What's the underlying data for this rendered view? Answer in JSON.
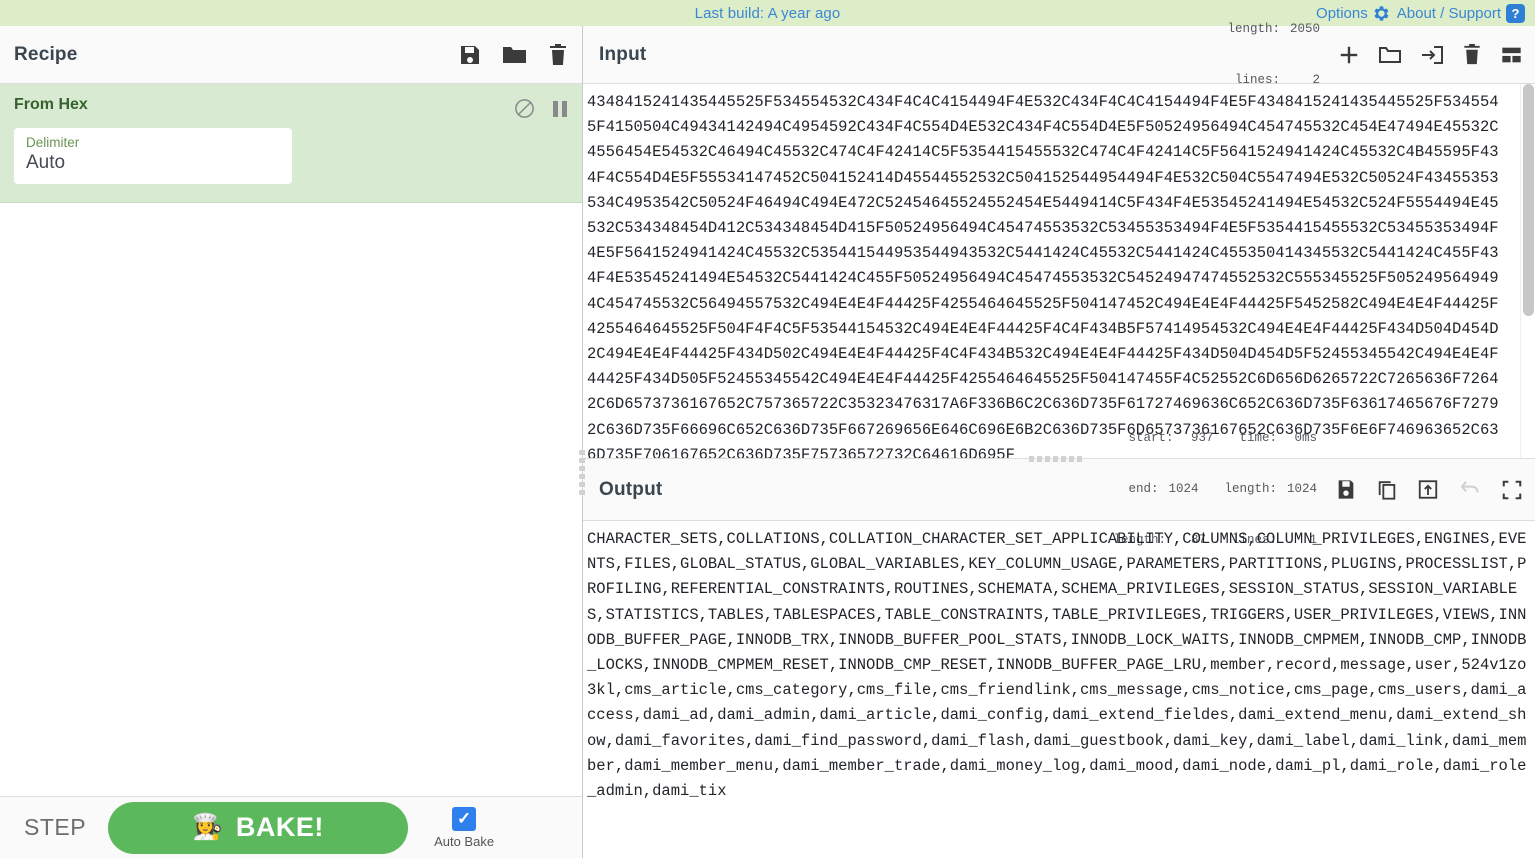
{
  "banner": {
    "build_text": "Last build: A year ago",
    "options_label": "Options",
    "about_label": "About / Support",
    "link_color": "#3a87d4",
    "background": "#dcedc8"
  },
  "recipe": {
    "title": "Recipe",
    "icons": [
      "save-icon",
      "folder-icon",
      "trash-icon"
    ],
    "operations": [
      {
        "name": "From Hex",
        "disable_icon": "disable-icon",
        "breakpoint_icon": "pause-icon",
        "args": [
          {
            "label": "Delimiter",
            "value": "Auto"
          }
        ]
      }
    ],
    "controls": {
      "step_label": "STEP",
      "bake_label": "BAKE!",
      "bake_emoji": "👩‍🍳",
      "bake_color": "#5cb85c",
      "autobake_label": "Auto Bake",
      "autobake_checked": true,
      "checkbox_color": "#2f80ed"
    }
  },
  "input": {
    "title": "Input",
    "stats": {
      "length_key": "length:",
      "length_value": "2050",
      "lines_key": "lines:",
      "lines_value": "2"
    },
    "icons": [
      "add-icon",
      "folder-open-icon",
      "import-icon",
      "trash-icon",
      "tabs-icon"
    ],
    "text": "4348415241435445525F534554532C434F4C4C4154494F4E532C434F4C4C4154494F4E5F4348415241435445525F5345545F4150504C49434142494C4954592C434F4C554D4E532C434F4C554D4E5F50524956494C454745532C454E47494E45532C4556454E54532C46494C45532C474C4F42414C5F5354415455532C474C4F42414C5F5641524941424C45532C4B45595F434F4C554D4E5F55534147452C504152414D45544552532C504152544954494F4E532C504C5547494E532C50524F43455353534C4953542C50524F46494C494E472C52454645524552454E5449414C5F434F4E53545241494E54532C524F5554494E45532C534348454D412C534348454D415F50524956494C45474553532C53455353494F4E5F5354415455532C53455353494F4E5F5641524941424C45532C535441544953544943532C5441424C45532C5441424C455350414345532C5441424C455F434F4E53545241494E54532C5441424C455F50524956494C45474553532C54524947474552532C555345525F5052495649494C454745532C56494557532C494E4E4F44425F4255464645525F504147452C494E4E4F44425F5452582C494E4E4F44425F4255464645525F504F4F4C5F53544154532C494E4E4F44425F4C4F434B5F57414954532C494E4E4F44425F434D504D454D2C494E4E4F44425F434D502C494E4E4F44425F4C4F434B532C494E4E4F44425F434D504D454D5F52455345542C494E4E4F44425F434D505F52455345542C494E4E4F44425F4255464645525F504147455F4C52552C6D656D6265722C7265636F72642C6D6573736167652C757365722C35323476317A6F336B6C2C636D735F61727469636C652C636D735F63617465676F72792C636D735F66696C652C636D735F667269656E646C696E6B2C636D735F6D6573736167652C636D735F6E6F746963652C636D735F706167652C636D735F75736572732C64616D695F"
  },
  "output": {
    "title": "Output",
    "stats": {
      "start_key": "start:",
      "start_value": "937",
      "end_key": "end:",
      "end_value": "1024",
      "sel_length_key": "length:",
      "sel_length_value": "87",
      "time_key": "time:",
      "time_value": "0ms",
      "length_key": "length:",
      "length_value": "1024",
      "lines_key": "lines:",
      "lines_value": "1"
    },
    "icons": [
      "save-icon",
      "copy-icon",
      "bake-to-input-icon",
      "undo-icon",
      "maximize-icon"
    ],
    "text": "CHARACTER_SETS,COLLATIONS,COLLATION_CHARACTER_SET_APPLICABILITY,COLUMNS,COLUMN_PRIVILEGES,ENGINES,EVENTS,FILES,GLOBAL_STATUS,GLOBAL_VARIABLES,KEY_COLUMN_USAGE,PARAMETERS,PARTITIONS,PLUGINS,PROCESSLIST,PROFILING,REFERENTIAL_CONSTRAINTS,ROUTINES,SCHEMATA,SCHEMA_PRIVILEGES,SESSION_STATUS,SESSION_VARIABLES,STATISTICS,TABLES,TABLESPACES,TABLE_CONSTRAINTS,TABLE_PRIVILEGES,TRIGGERS,USER_PRIVILEGES,VIEWS,INNODB_BUFFER_PAGE,INNODB_TRX,INNODB_BUFFER_POOL_STATS,INNODB_LOCK_WAITS,INNODB_CMPMEM,INNODB_CMP,INNODB_LOCKS,INNODB_CMPMEM_RESET,INNODB_CMP_RESET,INNODB_BUFFER_PAGE_LRU,member,record,message,user,524v1zo3kl,cms_article,cms_category,cms_file,cms_friendlink,cms_message,cms_notice,cms_page,cms_users,dami_access,dami_ad,dami_admin,dami_article,dami_config,dami_extend_fieldes,dami_extend_menu,dami_extend_show,dami_favorites,dami_find_password,dami_flash,dami_guestbook,dami_key,dami_label,dami_link,dami_member,dami_member_menu,dami_member_trade,dami_money_log,dami_mood,dami_node,dami_pl,dami_role,dami_role_admin,dami_tix"
  }
}
